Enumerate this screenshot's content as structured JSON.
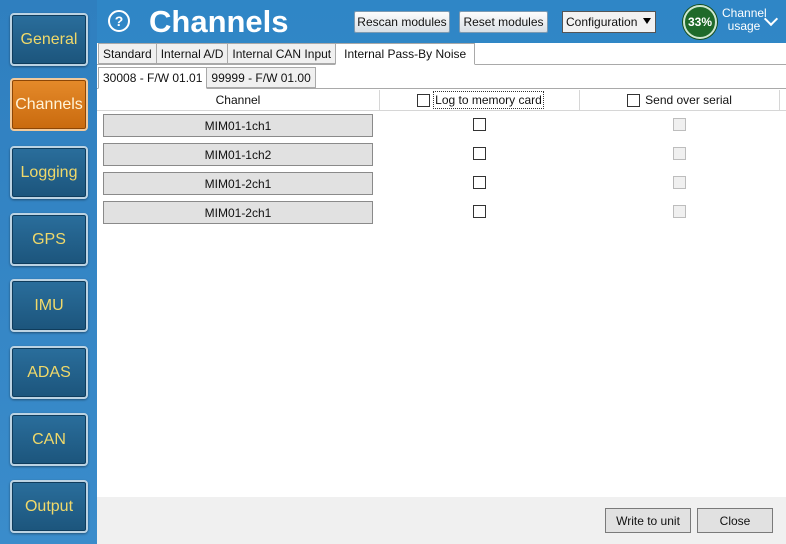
{
  "sidebar": {
    "items": [
      {
        "label": "General",
        "active": false
      },
      {
        "label": "Channels",
        "active": true
      },
      {
        "label": "Logging",
        "active": false
      },
      {
        "label": "GPS",
        "active": false
      },
      {
        "label": "IMU",
        "active": false
      },
      {
        "label": "ADAS",
        "active": false
      },
      {
        "label": "CAN",
        "active": false
      },
      {
        "label": "Output",
        "active": false
      }
    ]
  },
  "header": {
    "help_symbol": "?",
    "title": "Channels",
    "rescan_label": "Rescan modules",
    "reset_label": "Reset modules",
    "config_value": "Configuration",
    "usage_percent": "33%",
    "usage_label_line1": "Channel",
    "usage_label_line2": "usage"
  },
  "tabs": [
    {
      "label": "Standard",
      "active": false
    },
    {
      "label": "Internal A/D",
      "active": false
    },
    {
      "label": "Internal CAN Input",
      "active": false
    },
    {
      "label": "Internal Pass-By Noise",
      "active": true
    }
  ],
  "subtabs": [
    {
      "label": "30008 - F/W 01.01",
      "active": true
    },
    {
      "label": "99999 - F/W 01.00",
      "active": false
    }
  ],
  "grid": {
    "columns": [
      "Channel",
      "Log to memory card",
      "Send over serial"
    ],
    "rows": [
      {
        "channel": "MIM01-1ch1",
        "log": false,
        "serial": false
      },
      {
        "channel": "MIM01-1ch2",
        "log": false,
        "serial": false
      },
      {
        "channel": "MIM01-2ch1",
        "log": false,
        "serial": false
      },
      {
        "channel": "MIM01-2ch1",
        "log": false,
        "serial": false
      }
    ]
  },
  "footer": {
    "write_label": "Write to unit",
    "close_label": "Close"
  },
  "colors": {
    "background_blue": "#3a8cc6",
    "nav_button": "#1c557c",
    "nav_text": "#f0d96a",
    "nav_active": "#c96a0e",
    "gauge": "#1f6a2a"
  }
}
